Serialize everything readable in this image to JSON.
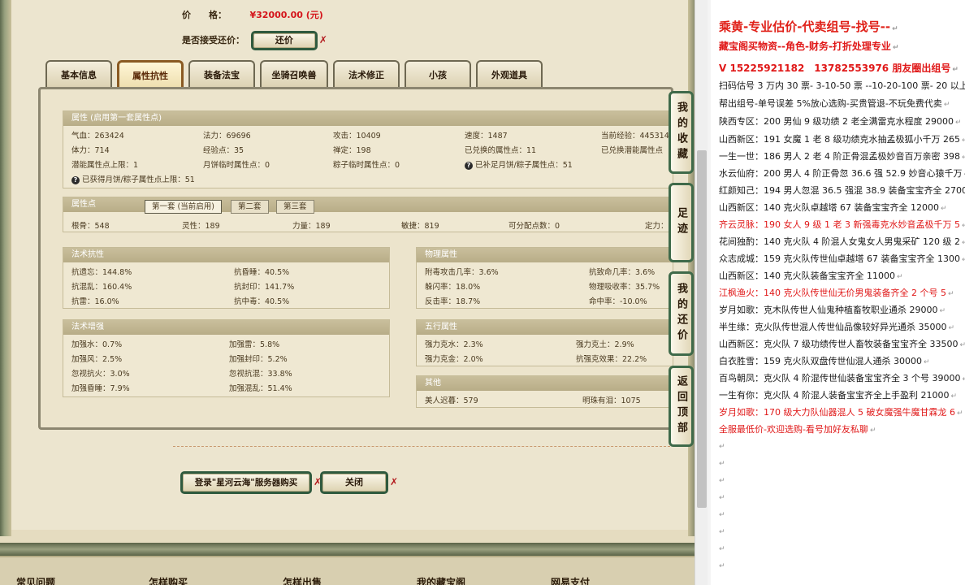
{
  "trade": {
    "price_label": "价　　格：",
    "price_value": "¥32000.00 (元)",
    "haggle_label": "是否接受还价：",
    "haggle_button": "还价"
  },
  "tabs": [
    "基本信息",
    "属性抗性",
    "装备法宝",
    "坐骑召唤兽",
    "法术修正",
    "小孩",
    "外观道具"
  ],
  "active_tab": "属性抗性",
  "attributes": {
    "header": "属性 (启用第一套属性点)",
    "row1": [
      "气血：263424",
      "法力：69696",
      "攻击：10409",
      "速度：1487",
      "当前经验：445314"
    ],
    "row2": [
      "体力：714",
      "经验点：35",
      "禅定：198",
      "已兑换的属性点：11",
      "已兑换潜能属性点"
    ],
    "row3": [
      "潜能属性点上限：1",
      "月饼临时属性点：0",
      "粽子临时属性点：0",
      "已补足月饼/粽子属性点：51"
    ],
    "row4": [
      "已获得月饼/粽子属性点上限：51"
    ]
  },
  "points": {
    "header": "属性点",
    "subtabs": [
      "第一套 (当前启用)",
      "第二套",
      "第三套"
    ],
    "row": [
      "根骨：548",
      "灵性：189",
      "力量：189",
      "敏捷：819",
      "可分配点数：0",
      "定力："
    ]
  },
  "magic_resist": {
    "header": "法术抗性",
    "rows": [
      [
        "抗遗忘：144.8%",
        "抗昏睡：40.5%"
      ],
      [
        "抗混乱：160.4%",
        "抗封印：141.7%"
      ],
      [
        "抗雷：16.0%",
        "抗中毒：40.5%"
      ]
    ]
  },
  "magic_boost": {
    "header": "法术增强",
    "rows": [
      [
        "加强水：0.7%",
        "加强雷：5.8%"
      ],
      [
        "加强风：2.5%",
        "加强封印：5.2%"
      ],
      [
        "忽视抗火：3.0%",
        "忽视抗混：33.8%"
      ],
      [
        "加强昏睡：7.9%",
        "加强混乱：51.4%"
      ]
    ]
  },
  "physical": {
    "header": "物理属性",
    "rows": [
      [
        "附毒攻击几率：3.6%",
        "抗致命几率：3.6%"
      ],
      [
        "躲闪率：18.0%",
        "物理吸收率：35.7%"
      ],
      [
        "反击率：18.7%",
        "命中率：-10.0%"
      ]
    ]
  },
  "five_elements": {
    "header": "五行属性",
    "rows": [
      [
        "强力克水：2.3%",
        "强力克土：2.9%"
      ],
      [
        "强力克金：2.0%",
        "抗强克效果：22.2%"
      ]
    ]
  },
  "other": {
    "header": "其他",
    "rows": [
      [
        "美人迟暮：579",
        "明珠有泪：1075"
      ]
    ]
  },
  "side_buttons": [
    "我的收藏",
    "足迹",
    "我的还价",
    "返回顶部"
  ],
  "bottom_buttons": {
    "login": "登录\"星河云海\"服务器购买",
    "close": "关闭"
  },
  "footer_links": [
    "常见问题",
    "怎样购买",
    "怎样出售",
    "我的藏宝阁",
    "网易支付"
  ],
  "right_panel": {
    "title": "乘黄-专业估价-代卖组号-找号--",
    "lines": [
      {
        "text": "藏宝阁买物资--角色-财务-打折处理专业",
        "style": "red"
      },
      {
        "text": "V 15225921182　13782553976 朋友圈出组号",
        "style": "red"
      },
      {
        "text": "扫码估号 3 万内 30 票- 3-10-50 票 --10-20-100 票- 20 以上",
        "style": "normal"
      },
      {
        "text": "帮出组号-单号误差 5%放心选购-买贵管退-不玩免费代卖",
        "style": "normal"
      },
      {
        "text": "陕西专区：200 男仙 9 级功绩 2 老全满雷克水程度 29000",
        "style": "normal"
      },
      {
        "text": "山西新区：191 女魔 1 老 8 级功绩克水抽孟极狐小千万 265",
        "style": "normal"
      },
      {
        "text": "一生一世：186 男人 2 老 4 阶正骨混孟极妙音百万亲密 398",
        "style": "normal"
      },
      {
        "text": "水云仙府：200 男人 4 阶正骨忽 36.6 强 52.9 妙音心猿千万",
        "style": "normal"
      },
      {
        "text": "红颜知己：194 男人忽混 36.5 强混 38.9 装备宝宝齐全 2700",
        "style": "normal"
      },
      {
        "text": "山西新区：140 克火队卓越塔 67 装备宝宝齐全 12000",
        "style": "normal"
      },
      {
        "text": "齐云灵脉：190 女人 9 级 1 老 3 新强毒克水妙音孟极千万 5",
        "style": "red"
      },
      {
        "text": "花间独酌：140 克火队 4 阶混人女鬼女人男鬼采矿 120 级 2",
        "style": "normal"
      },
      {
        "text": "众志成城：159 克火队传世仙卓越塔 67 装备宝宝齐全 1300",
        "style": "normal"
      },
      {
        "text": "山西新区：140 克火队装备宝宝齐全 11000",
        "style": "normal"
      },
      {
        "text": "江枫渔火：140 克火队传世仙无价男鬼装备齐全 2 个号 5",
        "style": "red"
      },
      {
        "text": "岁月如歌：克木队传世人仙鬼种植畜牧职业通杀 29000",
        "style": "normal"
      },
      {
        "text": "半生缘：克火队传世混人传世仙品像较好异光通杀 35000",
        "style": "normal"
      },
      {
        "text": "山西新区：克火队 7 级功绩传世人畜牧装备宝宝齐全 33500",
        "style": "normal"
      },
      {
        "text": "白衣胜雪：159 克火队双盘传世仙混人通杀 30000",
        "style": "normal"
      },
      {
        "text": "百鸟朝凤：克火队 4 阶混传世仙装备宝宝齐全 3 个号 39000",
        "style": "normal"
      },
      {
        "text": "一生有你：克火队 4 阶混人装备宝宝齐全上手盈利 21000",
        "style": "normal"
      },
      {
        "text": "岁月如歌：170 级大力队仙器混人 5 破女魔强牛魔甘霖龙 6",
        "style": "red"
      },
      {
        "text": "全服最低价-欢迎选购-看号加好友私聊",
        "style": "red"
      }
    ],
    "paragraph_mark": "↵"
  },
  "colors": {
    "price_red": "#d4141a",
    "button_border": "#2f5a3e",
    "section_header": "#b8ad87",
    "right_red": "#e01818"
  }
}
